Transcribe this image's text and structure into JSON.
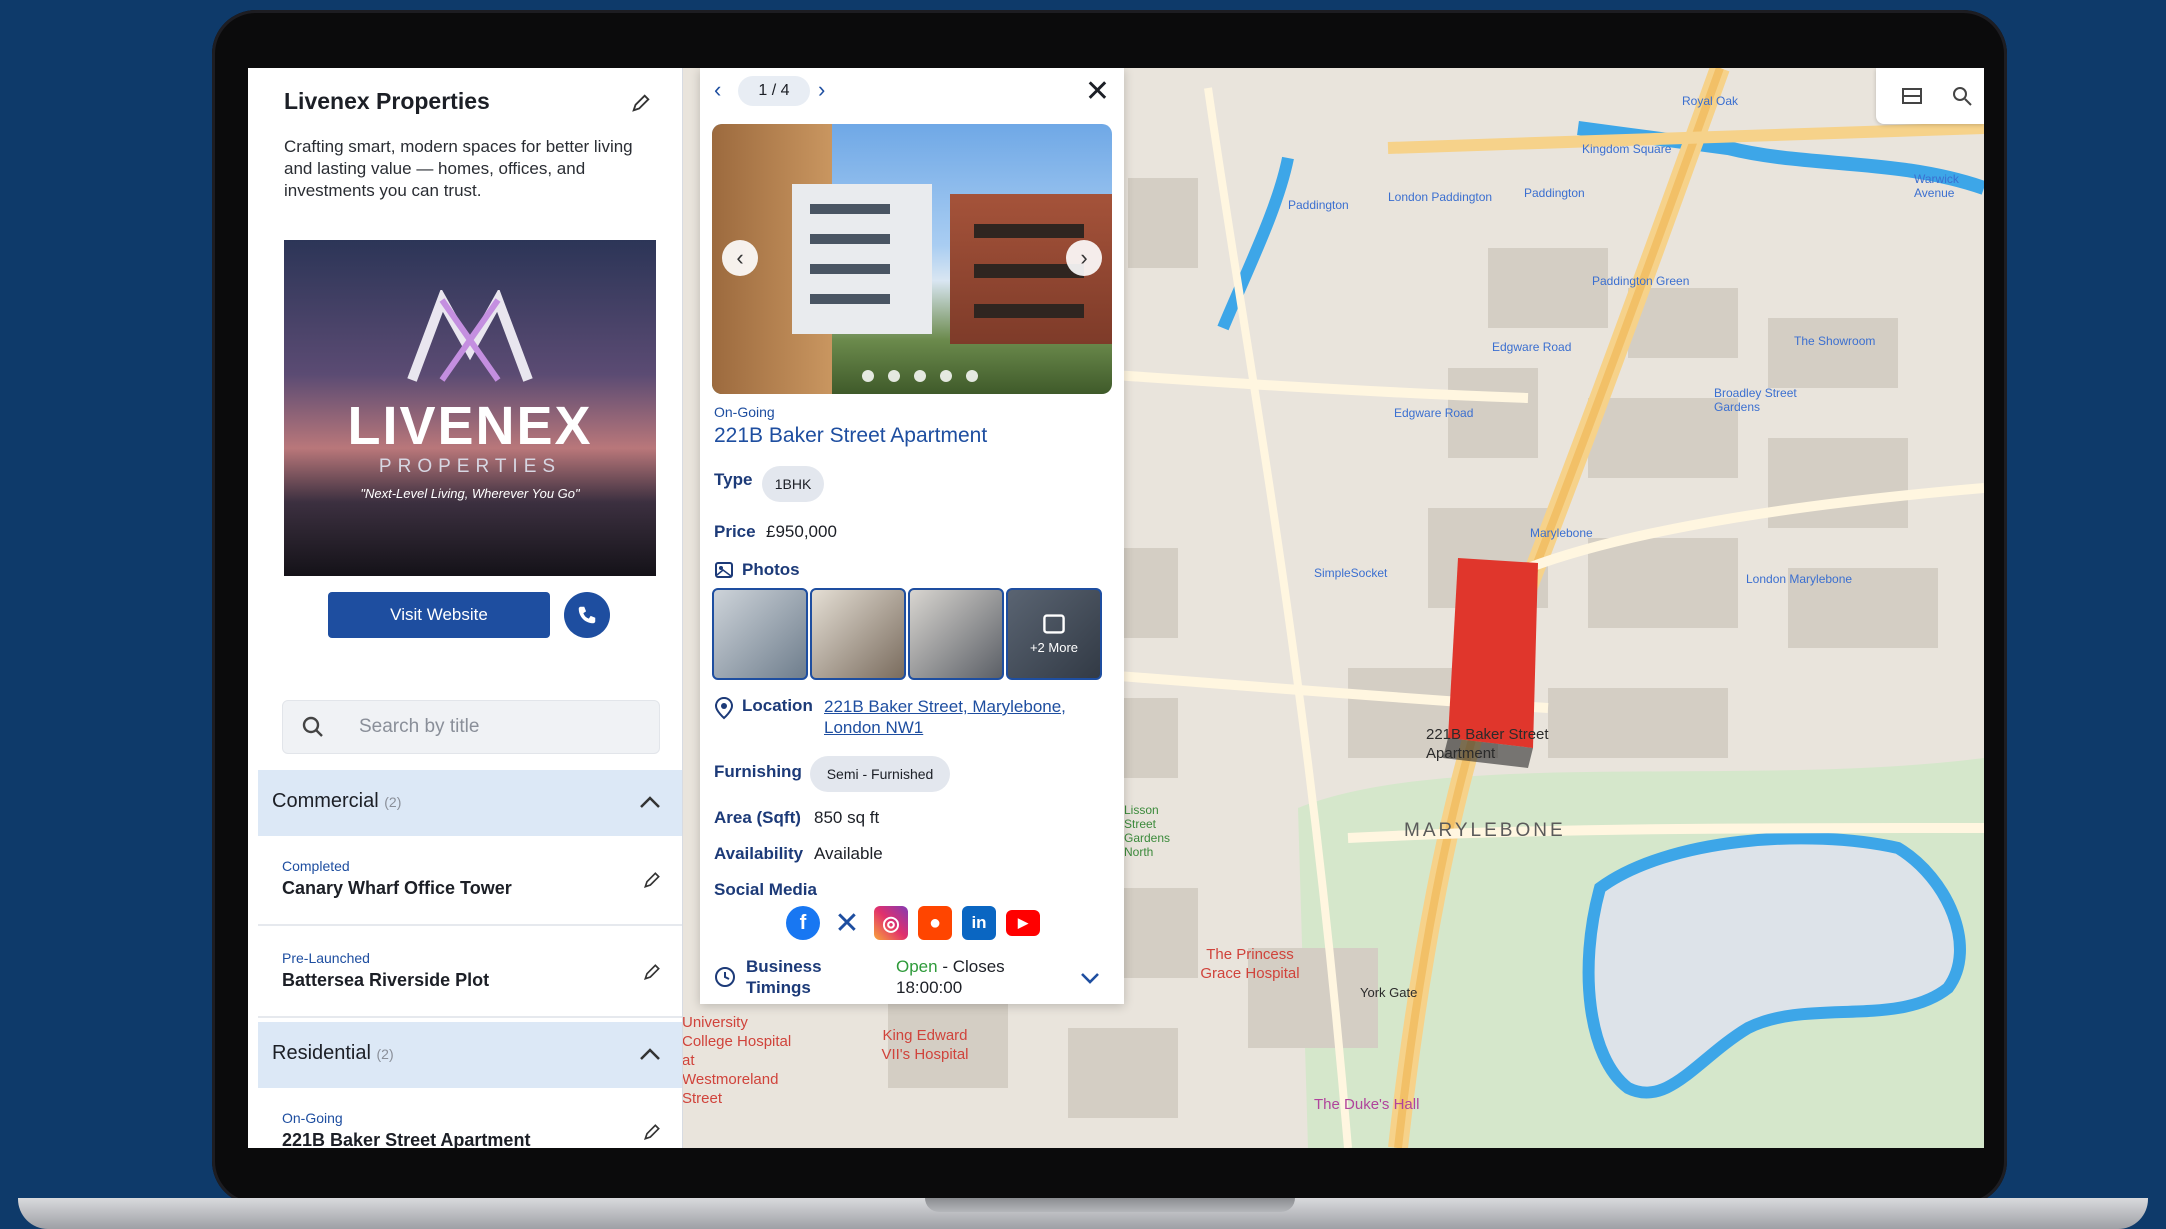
{
  "left_panel": {
    "brand_title": "Livenex Properties",
    "description": "Crafting smart, modern spaces for better living and lasting value — homes, offices, and investments you can trust.",
    "logo": {
      "word": "LIVENEX",
      "sub": "PROPERTIES",
      "tagline": "\"Next-Level Living, Wherever You Go\""
    },
    "visit_button": "Visit Website",
    "search_placeholder": "Search by title",
    "groups": [
      {
        "title": "Commercial",
        "count": "(2)",
        "items": [
          {
            "status": "Completed",
            "title": "Canary Wharf Office Tower"
          },
          {
            "status": "Pre-Launched",
            "title": "Battersea Riverside Plot"
          }
        ]
      },
      {
        "title": "Residential",
        "count": "(2)",
        "items": [
          {
            "status": "On-Going",
            "title": "221B Baker Street Apartment"
          }
        ]
      }
    ]
  },
  "detail": {
    "pager": "1 / 4",
    "status": "On-Going",
    "title": "221B Baker Street Apartment",
    "type_label": "Type",
    "type_value": "1BHK",
    "price_label": "Price",
    "price_value": "£950,000",
    "photos_label": "Photos",
    "more_photos": "+2 More",
    "location_label": "Location",
    "location_value": "221B Baker Street, Marylebone, London NW1",
    "furnishing_label": "Furnishing",
    "furnishing_value": "Semi - Furnished",
    "area_label": "Area (Sqft)",
    "area_value": "850 sq ft",
    "availability_label": "Availability",
    "availability_value": "Available",
    "social_label": "Social Media",
    "social_icons": [
      "facebook-icon",
      "x-icon",
      "instagram-icon",
      "reddit-icon",
      "linkedin-icon",
      "youtube-icon"
    ],
    "hours_label": "Business Timings",
    "hours_open": "Open",
    "hours_rest": " - Closes 18:00:00"
  },
  "map": {
    "area_name": "MARYLEBONE",
    "highlight_label": "221B Baker Street Apartment",
    "pois": [
      "Royal Oak",
      "Kingdom Square",
      "Paddington",
      "London Paddington",
      "Paddington",
      "Warwick Avenue",
      "Paddington Green",
      "Edgware Road",
      "The Showroom",
      "Broadley Street Gardens",
      "Edgware Road",
      "Marylebone",
      "SimpleSocket",
      "London Marylebone"
    ],
    "hospitals": [
      "The Princess Grace Hospital",
      "King Edward VII's Hospital",
      "University College Hospital at Westmoreland Street"
    ],
    "other_labels": [
      "York Gate",
      "The Duke's Hall",
      "Lisson Street Gardens North"
    ]
  },
  "colors": {
    "brand_blue": "#1e4ea0",
    "highlight_red": "#e0362c",
    "background_navy": "#0e3a6a"
  }
}
